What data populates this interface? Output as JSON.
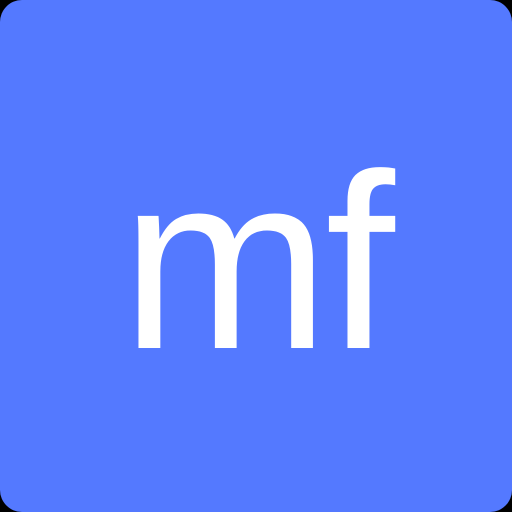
{
  "icon": {
    "text": "mf",
    "background_color": "#5479FF",
    "text_color": "#FFFFFF"
  },
  "page": {
    "background_color": "#000000"
  }
}
